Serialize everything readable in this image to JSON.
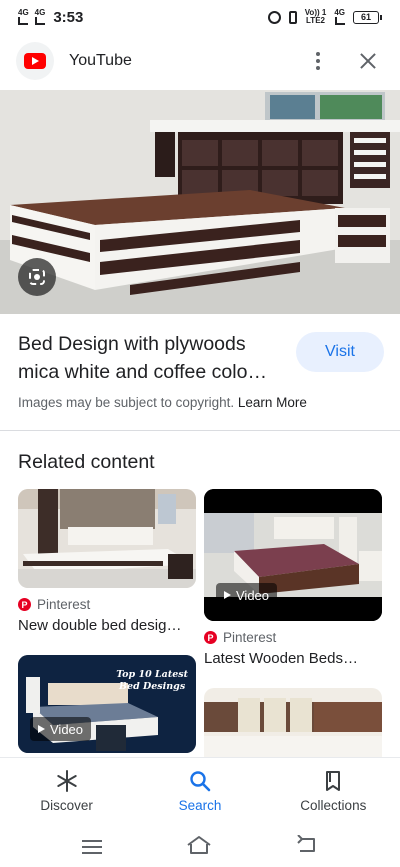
{
  "status_bar": {
    "net1": "4G",
    "net2": "4G",
    "time": "3:53",
    "volte_top": "Vo)) 1",
    "volte_bottom": "LTE2",
    "net3": "4G",
    "battery": "61"
  },
  "header": {
    "source_name": "YouTube",
    "logo_icon": "youtube-logo",
    "more_icon": "more-vert-icon",
    "close_icon": "close-icon"
  },
  "result": {
    "title": "Bed Design with plywoods mica white and coffee colo…",
    "visit_label": "Visit",
    "copyright_text": "Images may be subject to copyright.",
    "learn_more": "Learn More"
  },
  "related": {
    "heading": "Related content",
    "cards": [
      {
        "source": "Pinterest",
        "title": "New double bed desig…",
        "badge": ""
      },
      {
        "source": "Pinterest",
        "title": "Latest Wooden Beds…",
        "badge": "Video"
      },
      {
        "source": "",
        "title": "",
        "badge": "Video",
        "overlay_line1": "Top 10 Latest",
        "overlay_line2": "Bed Desings"
      },
      {
        "source": "",
        "title": "",
        "badge": ""
      }
    ]
  },
  "bottom_nav": {
    "items": [
      {
        "label": "Discover",
        "icon": "asterisk-icon"
      },
      {
        "label": "Search",
        "icon": "search-icon",
        "active": true
      },
      {
        "label": "Collections",
        "icon": "collections-icon"
      }
    ]
  },
  "colors": {
    "accent": "#1a73e8",
    "visit_bg": "#e8f0fe",
    "pinterest": "#e60023",
    "youtube": "#ff0000"
  }
}
